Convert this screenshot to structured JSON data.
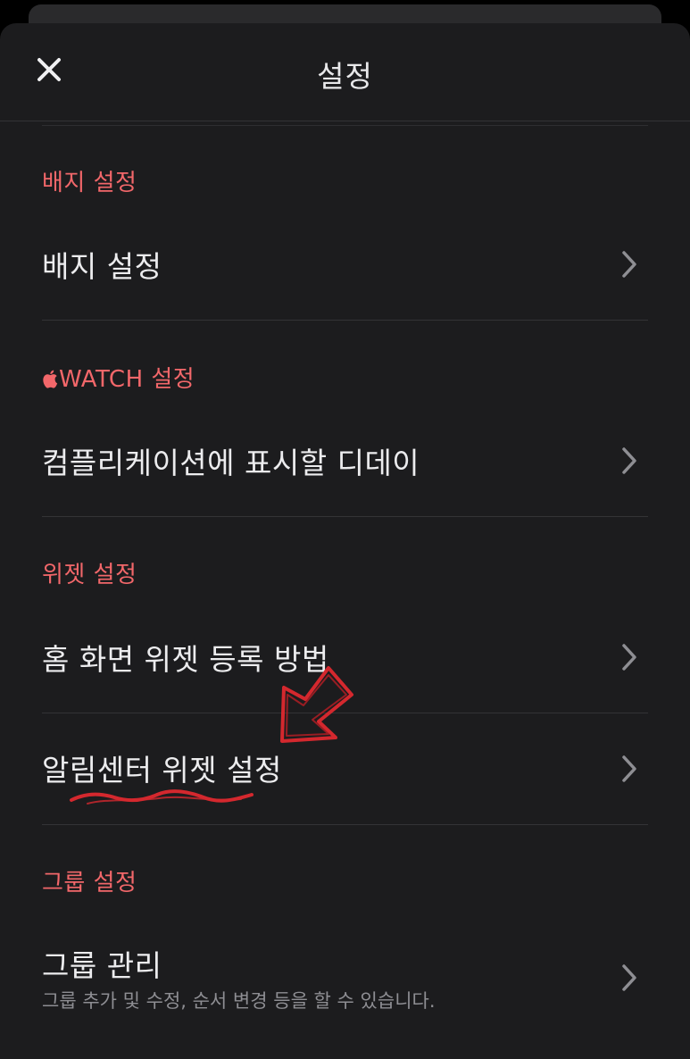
{
  "header": {
    "title": "설정",
    "close_icon": "close-icon"
  },
  "sections": [
    {
      "header": "배지 설정",
      "items": [
        {
          "label": "배지 설정"
        }
      ]
    },
    {
      "header": "WATCH 설정",
      "header_icon": "apple-logo-icon",
      "items": [
        {
          "label": "컴플리케이션에 표시할 디데이"
        }
      ]
    },
    {
      "header": "위젯 설정",
      "items": [
        {
          "label": "홈 화면 위젯 등록 방법"
        },
        {
          "label": "알림센터 위젯 설정"
        }
      ]
    },
    {
      "header": "그룹 설정",
      "items": [
        {
          "label": "그룹 관리",
          "subtitle": "그룹 추가 및 수정, 순서 변경 등을 할 수 있습니다."
        }
      ]
    }
  ],
  "annotation": {
    "type": "hand-drawn arrow and underline",
    "target": "알림센터 위젯 설정",
    "color": "#d4282e"
  },
  "colors": {
    "background": "#1c1c1e",
    "section_header": "#f2676a",
    "text": "#ececee",
    "chevron": "#8e8e93",
    "subtitle": "#8e8e93"
  }
}
